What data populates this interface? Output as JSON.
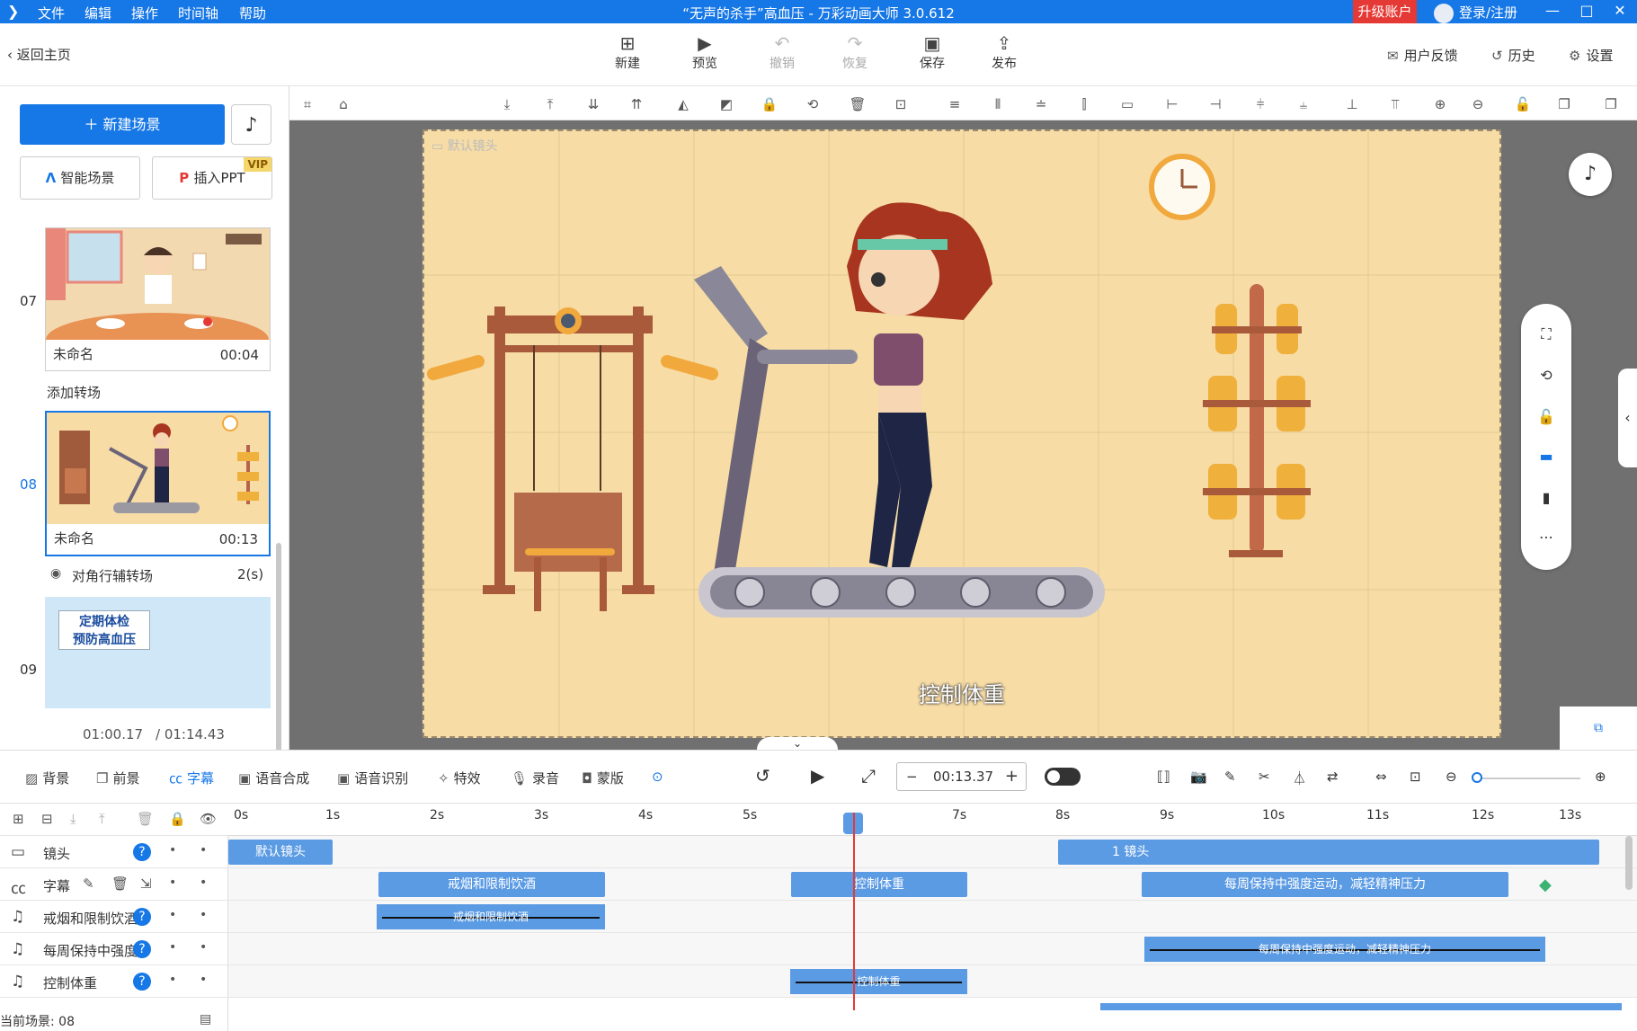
{
  "menu": {
    "items": [
      "文件",
      "编辑",
      "操作",
      "时间轴",
      "帮助"
    ],
    "title": "“无声的杀手”高血压 - 万彩动画大师 3.0.612",
    "upgrade": "升级账户",
    "login": "登录/注册"
  },
  "toolbar": {
    "back": "返回主页",
    "new": "新建",
    "preview": "预览",
    "undo": "撤销",
    "redo": "恢复",
    "save": "保存",
    "publish": "发布",
    "feedback": "用户反馈",
    "history": "历史",
    "settings": "设置"
  },
  "left": {
    "new_scene": "新建场景",
    "smart_scene": "智能场景",
    "insert_ppt": "插入PPT",
    "vip": "VIP",
    "scenes": [
      {
        "num": "07",
        "name": "未命名",
        "duration": "00:04"
      },
      {
        "num": "08",
        "name": "未命名",
        "duration": "00:13"
      },
      {
        "num": "09",
        "name": "",
        "duration": ""
      }
    ],
    "add_transition": "添加转场",
    "transition": {
      "name": "对角行辅转场",
      "duration": "2(s)"
    },
    "scene9_text1": "定期体检",
    "scene9_text2": "预防高血压",
    "time_current": "01:00.17",
    "time_total": "/ 01:14.43"
  },
  "stage": {
    "camera_label": "默认镜头",
    "subtitle": "控制体重"
  },
  "timeline_toolbar": {
    "items": [
      "背景",
      "前景",
      "字幕",
      "语音合成",
      "语音识别",
      "特效",
      "录音",
      "蒙版"
    ],
    "time": "00:13.37"
  },
  "ruler": [
    "0s",
    "1s",
    "2s",
    "3s",
    "4s",
    "5s",
    "7s",
    "8s",
    "9s",
    "10s",
    "11s",
    "12s",
    "13s"
  ],
  "tracks": [
    {
      "name": "镜头",
      "clips": [
        "默认镜头",
        "1 镜头"
      ]
    },
    {
      "name": "字幕",
      "clips": [
        "戒烟和限制饮酒",
        "控制体重",
        "每周保持中强度运动，减轻精神压力"
      ]
    },
    {
      "name": "戒烟和限制饮酒",
      "clips": [
        "戒烟和限制饮酒"
      ]
    },
    {
      "name": "每周保持中强度运动",
      "clips": [
        "每周保持中强度运动，减轻精神压力"
      ]
    },
    {
      "name": "控制体重",
      "clips": [
        "控制体重"
      ]
    }
  ],
  "status": {
    "current_scene": "当前场景: 08"
  }
}
